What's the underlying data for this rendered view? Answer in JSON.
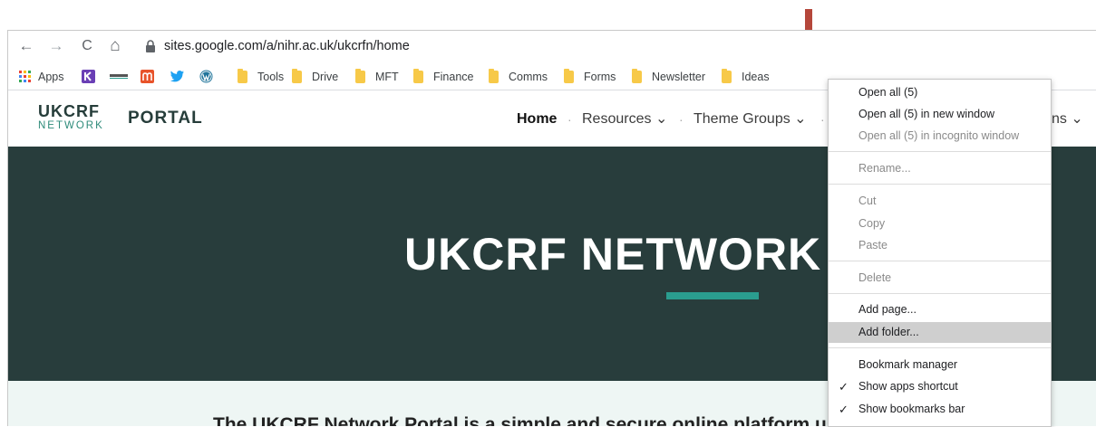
{
  "browser": {
    "url": "sites.google.com/a/nihr.ac.uk/ukcrfn/home",
    "nav": {
      "back": "←",
      "forward": "→",
      "reload": "C",
      "home": "⌂"
    }
  },
  "bookmarks_bar": {
    "apps_label": "Apps",
    "folders": [
      "Tools",
      "Drive",
      "MFT",
      "Finance",
      "Comms",
      "Forms",
      "Newsletter",
      "Ideas"
    ]
  },
  "site": {
    "logo_top": "UKCRF",
    "logo_bottom": "NETWORK",
    "portal": "PORTAL",
    "nav": {
      "home": "Home",
      "resources": "Resources",
      "theme_groups": "Theme Groups",
      "partial": "ns"
    },
    "hero_title": "UKCRF NETWORK",
    "intro_text": "The UKCRF Network Portal is a simple and secure online platform used to store and share"
  },
  "context_menu": {
    "items": [
      {
        "label": "Open all (5)",
        "enabled": true
      },
      {
        "label": "Open all (5) in new window",
        "enabled": true
      },
      {
        "label": "Open all (5) in incognito window",
        "enabled": false
      },
      {
        "label": "Rename...",
        "enabled": false
      },
      {
        "label": "Cut",
        "enabled": false
      },
      {
        "label": "Copy",
        "enabled": false
      },
      {
        "label": "Paste",
        "enabled": false
      },
      {
        "label": "Delete",
        "enabled": false
      },
      {
        "label": "Add page...",
        "enabled": true
      },
      {
        "label": "Add folder...",
        "enabled": true,
        "highlighted": true
      },
      {
        "label": "Bookmark manager",
        "enabled": true
      },
      {
        "label": "Show apps shortcut",
        "enabled": true,
        "checked": true
      },
      {
        "label": "Show bookmarks bar",
        "enabled": true,
        "checked": true
      }
    ]
  },
  "colors": {
    "hero_bg": "#283d3c",
    "accent": "#2a9d8f",
    "arrow": "#b5473b",
    "folder": "#f7c948"
  }
}
